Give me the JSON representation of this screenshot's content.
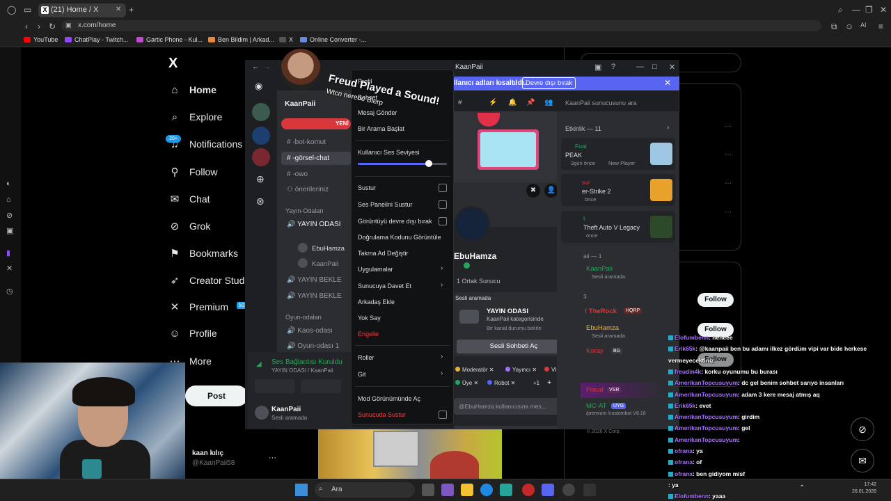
{
  "browser": {
    "tab_title": "(21) Home / X",
    "url": "x.com/home",
    "bookmarks": [
      "YouTube",
      "ChatPlay - Twitch...",
      "Gartic Phone - Kul...",
      "Ben Bildim | Arkad...",
      "X",
      "Online Converter -..."
    ]
  },
  "x_sidebar": {
    "logo": "X",
    "items": [
      {
        "icon": "home-icon",
        "label": "Home"
      },
      {
        "icon": "search-icon",
        "label": "Explore"
      },
      {
        "icon": "bell-icon",
        "label": "Notifications",
        "badge": "20+"
      },
      {
        "icon": "add-user-icon",
        "label": "Follow"
      },
      {
        "icon": "mail-icon",
        "label": "Chat"
      },
      {
        "icon": "grok-icon",
        "label": "Grok"
      },
      {
        "icon": "bookmark-icon",
        "label": "Bookmarks"
      },
      {
        "icon": "rocket-icon",
        "label": "Creator Stud"
      },
      {
        "icon": "x-icon",
        "label": "Premium"
      },
      {
        "icon": "person-icon",
        "label": "Profile"
      },
      {
        "icon": "more-icon",
        "label": "More"
      }
    ],
    "premium_badge": "50",
    "post_label": "Post",
    "account_name": "kaan kılıç",
    "account_handle": "@KaanPaii58",
    "more": "···"
  },
  "x_right": {
    "follow_label": "Follow",
    "footer": "© 2026 X Corp."
  },
  "discord": {
    "window_title": "KaanPaii",
    "banner_text": "llanıcı adları kısaltıldı.",
    "banner_button": "Devre dışı bırak",
    "server_name": "KaanPaii",
    "new_label": "YENİ",
    "channels": [
      "-bot-komut",
      "-görsel-chat",
      "-owo",
      "önerileriniz"
    ],
    "category_voice": "Yayın-Odaları",
    "voice_channel": "YAYIN ODASI",
    "voice_users": [
      "EbuHamza",
      "KaanPaii"
    ],
    "waiting_channels": [
      "YAYIN BEKLE",
      "YAYIN BEKLE"
    ],
    "category_game": "Oyun-odaları",
    "game_channels": [
      "Kaos-odası",
      "Oyun-odası 1"
    ],
    "voice_status": "Ses Bağlantısı Kuruldu",
    "voice_sub": "YAYIN ODASI / KaanPaii",
    "user_name": "KaanPaii",
    "user_status": "Sesli aramada",
    "search_placeholder": "KaanPaii sunucusunu ara",
    "sound_title": "Freud Played a Sound!",
    "sound_sub": "Wtcn nerede Blerp"
  },
  "context_menu": {
    "profile": "Profil",
    "mention": "Bahset",
    "send_message": "Mesaj Gönder",
    "start_call": "Bir Arama Başlat",
    "volume_label": "Kullanıcı Ses Seviyesi",
    "volume": 0.8,
    "mute": "Sustur",
    "soundboard_mute": "Ses Panelini Sustur",
    "disable_video": "Görüntüyü devre dışı bırak",
    "verify_code": "Doğrulama Kodunu Görüntüle",
    "nickname": "Takma Ad Değiştir",
    "apps": "Uygulamalar",
    "invite": "Sunucuya Davet Et",
    "add_friend": "Arkadaş Ekle",
    "ignore": "Yok Say",
    "block": "Engelle",
    "roles": "Roller",
    "go": "Git",
    "mod_view": "Mod Görünümünde Aç",
    "server_mute": "Sunucuda Sustur"
  },
  "profile_card": {
    "name": "EbuHamza",
    "mutual": "1 Ortak Sunucu",
    "voice_label": "Sesli aramada",
    "voice_title": "YAYIN ODASI",
    "voice_sub": "KaanPaii kategorisinde",
    "voice_sub2": "Bir kanal durumu belirle",
    "voice_button": "Sesli Sohbeti Aç",
    "roles": [
      {
        "name": "Moderatör",
        "color": "#f0b232"
      },
      {
        "name": "Yayıncı",
        "color": "#a970ff"
      },
      {
        "name": "VIP",
        "color": "#da373c"
      },
      {
        "name": "Üye",
        "color": "#23a55a"
      },
      {
        "name": "Robot",
        "color": "#5865f2"
      }
    ],
    "more_roles": "+1",
    "message_placeholder": "@EbuHamza kullanıcısına mes..."
  },
  "activity": {
    "title": "Etkinlik — 11",
    "items": [
      {
        "user": "Fuat",
        "game": "PEAK",
        "time": "3gün önce",
        "tag": "New Player"
      },
      {
        "user": "sar",
        "game": "er-Strike 2",
        "time": "önce",
        "tag": ""
      },
      {
        "user": "t",
        "game": "Theft Auto V Legacy",
        "time": "önce",
        "tag": ""
      }
    ],
    "members_header": "aii — 1",
    "member1": "KaanPaii",
    "member1_status": "Sesli aramada",
    "count3": "3",
    "member2": "! TheRock",
    "member2_tag": "HQRP",
    "member3": "EbuHamza",
    "member3_status": "Sesli aramada",
    "member4": "Koray",
    "member4_tag": "BG",
    "member5": "Freud",
    "member5_tag": "VSR",
    "member6": "MC-AT",
    "member6_tag": "UYG",
    "member6_status": "/premium /custombot V8.18"
  },
  "chat": [
    {
      "user": "Elofumbenn",
      "msg": ": heheee"
    },
    {
      "user": "Erik65k",
      "msg": ": @kaanpaii ben bu adamı ilkez gördüm vipi var bide herkese"
    },
    {
      "user": "",
      "msg": "vermeyecektiniz"
    },
    {
      "user": "freudin4k",
      "msg": ": korku oyunumu bu burası"
    },
    {
      "user": "AmerikanTopcusuyum",
      "msg": ": dc gel benim sohbet sarıyo insanları"
    },
    {
      "user": "AmerikanTopcusuyum",
      "msg": ": adam 3 kere mesaj atmış aq"
    },
    {
      "user": "Erik65k",
      "msg": ": evet"
    },
    {
      "user": "AmerikanTopcusuyum",
      "msg": ": girdim"
    },
    {
      "user": "AmerikanTopcusuyum",
      "msg": ": gel"
    },
    {
      "user": "AmerikanTopcusuyum",
      "msg": ":"
    },
    {
      "user": "ofrana",
      "msg": ": ya"
    },
    {
      "user": "ofrana",
      "msg": ": of"
    },
    {
      "user": "ofrana",
      "msg": ": ben gidiyom misf"
    },
    {
      "user": "",
      "msg": ": ya"
    },
    {
      "user": "Elofumbenn",
      "msg": ": yaaa"
    }
  ],
  "taskbar": {
    "search": "Ara",
    "time": "17:42",
    "date": "26.01.2026"
  }
}
